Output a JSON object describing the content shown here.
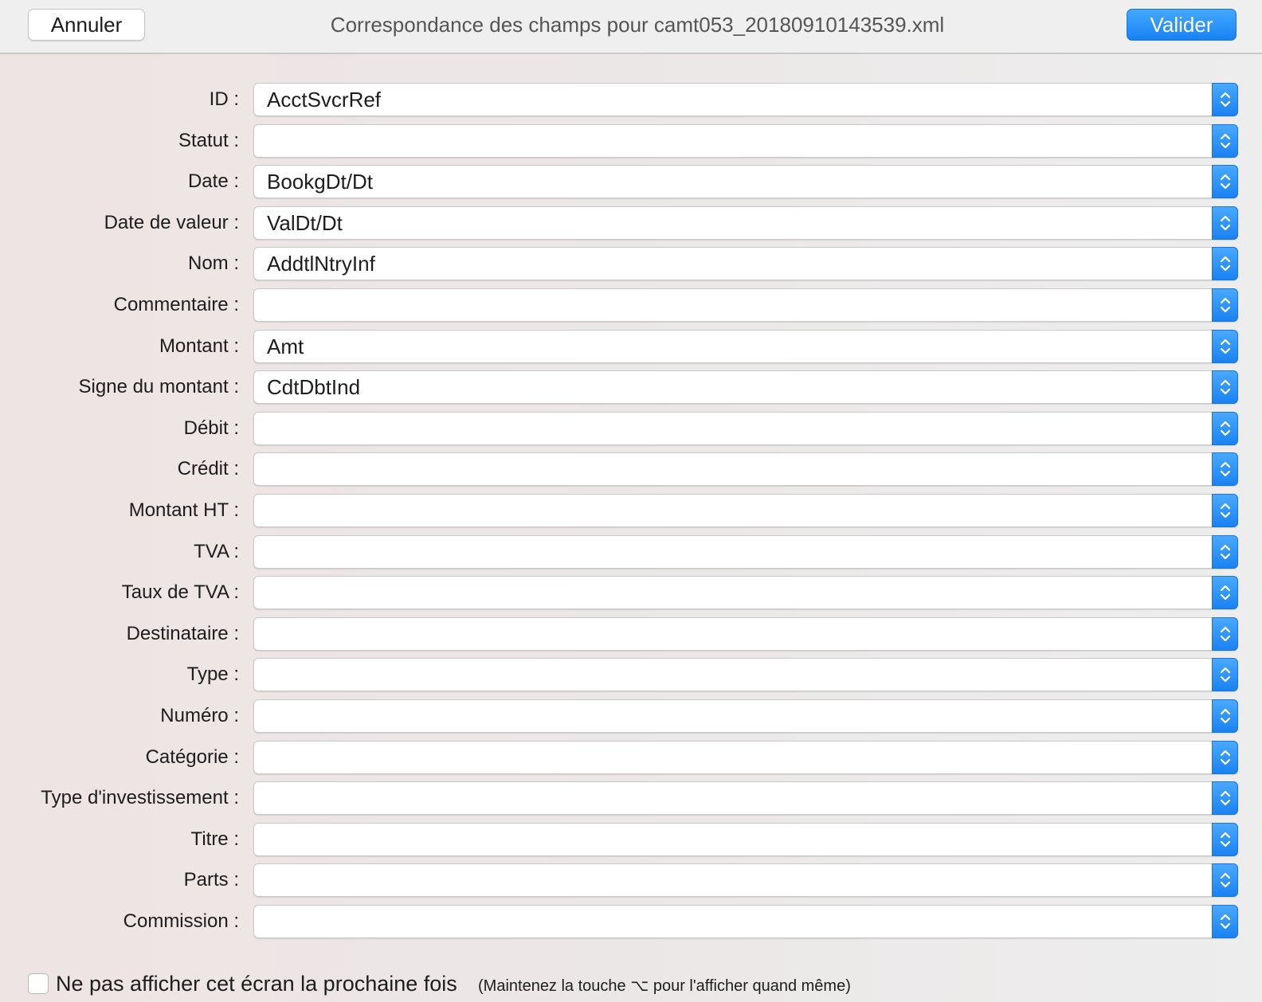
{
  "header": {
    "cancel_label": "Annuler",
    "title": "Correspondance des champs pour camt053_20180910143539.xml",
    "confirm_label": "Valider"
  },
  "fields": [
    {
      "label": "ID :",
      "value": "AcctSvcrRef"
    },
    {
      "label": "Statut :",
      "value": ""
    },
    {
      "label": "Date :",
      "value": "BookgDt/Dt"
    },
    {
      "label": "Date de valeur :",
      "value": "ValDt/Dt"
    },
    {
      "label": "Nom :",
      "value": "AddtlNtryInf"
    },
    {
      "label": "Commentaire :",
      "value": ""
    },
    {
      "label": "Montant :",
      "value": "Amt"
    },
    {
      "label": "Signe du montant :",
      "value": "CdtDbtInd"
    },
    {
      "label": "Débit :",
      "value": ""
    },
    {
      "label": "Crédit :",
      "value": ""
    },
    {
      "label": "Montant HT :",
      "value": ""
    },
    {
      "label": "TVA :",
      "value": ""
    },
    {
      "label": "Taux de TVA :",
      "value": ""
    },
    {
      "label": "Destinataire :",
      "value": ""
    },
    {
      "label": "Type :",
      "value": ""
    },
    {
      "label": "Numéro :",
      "value": ""
    },
    {
      "label": "Catégorie :",
      "value": ""
    },
    {
      "label": "Type d'investissement :",
      "value": ""
    },
    {
      "label": "Titre :",
      "value": ""
    },
    {
      "label": "Parts :",
      "value": ""
    },
    {
      "label": "Commission :",
      "value": ""
    }
  ],
  "footer": {
    "dont_show_label": "Ne pas afficher cet écran la prochaine fois",
    "hint": "(Maintenez la touche ⌥ pour l'afficher quand même)"
  },
  "colors": {
    "accent": "#1a82f1",
    "background": "#ececec"
  }
}
